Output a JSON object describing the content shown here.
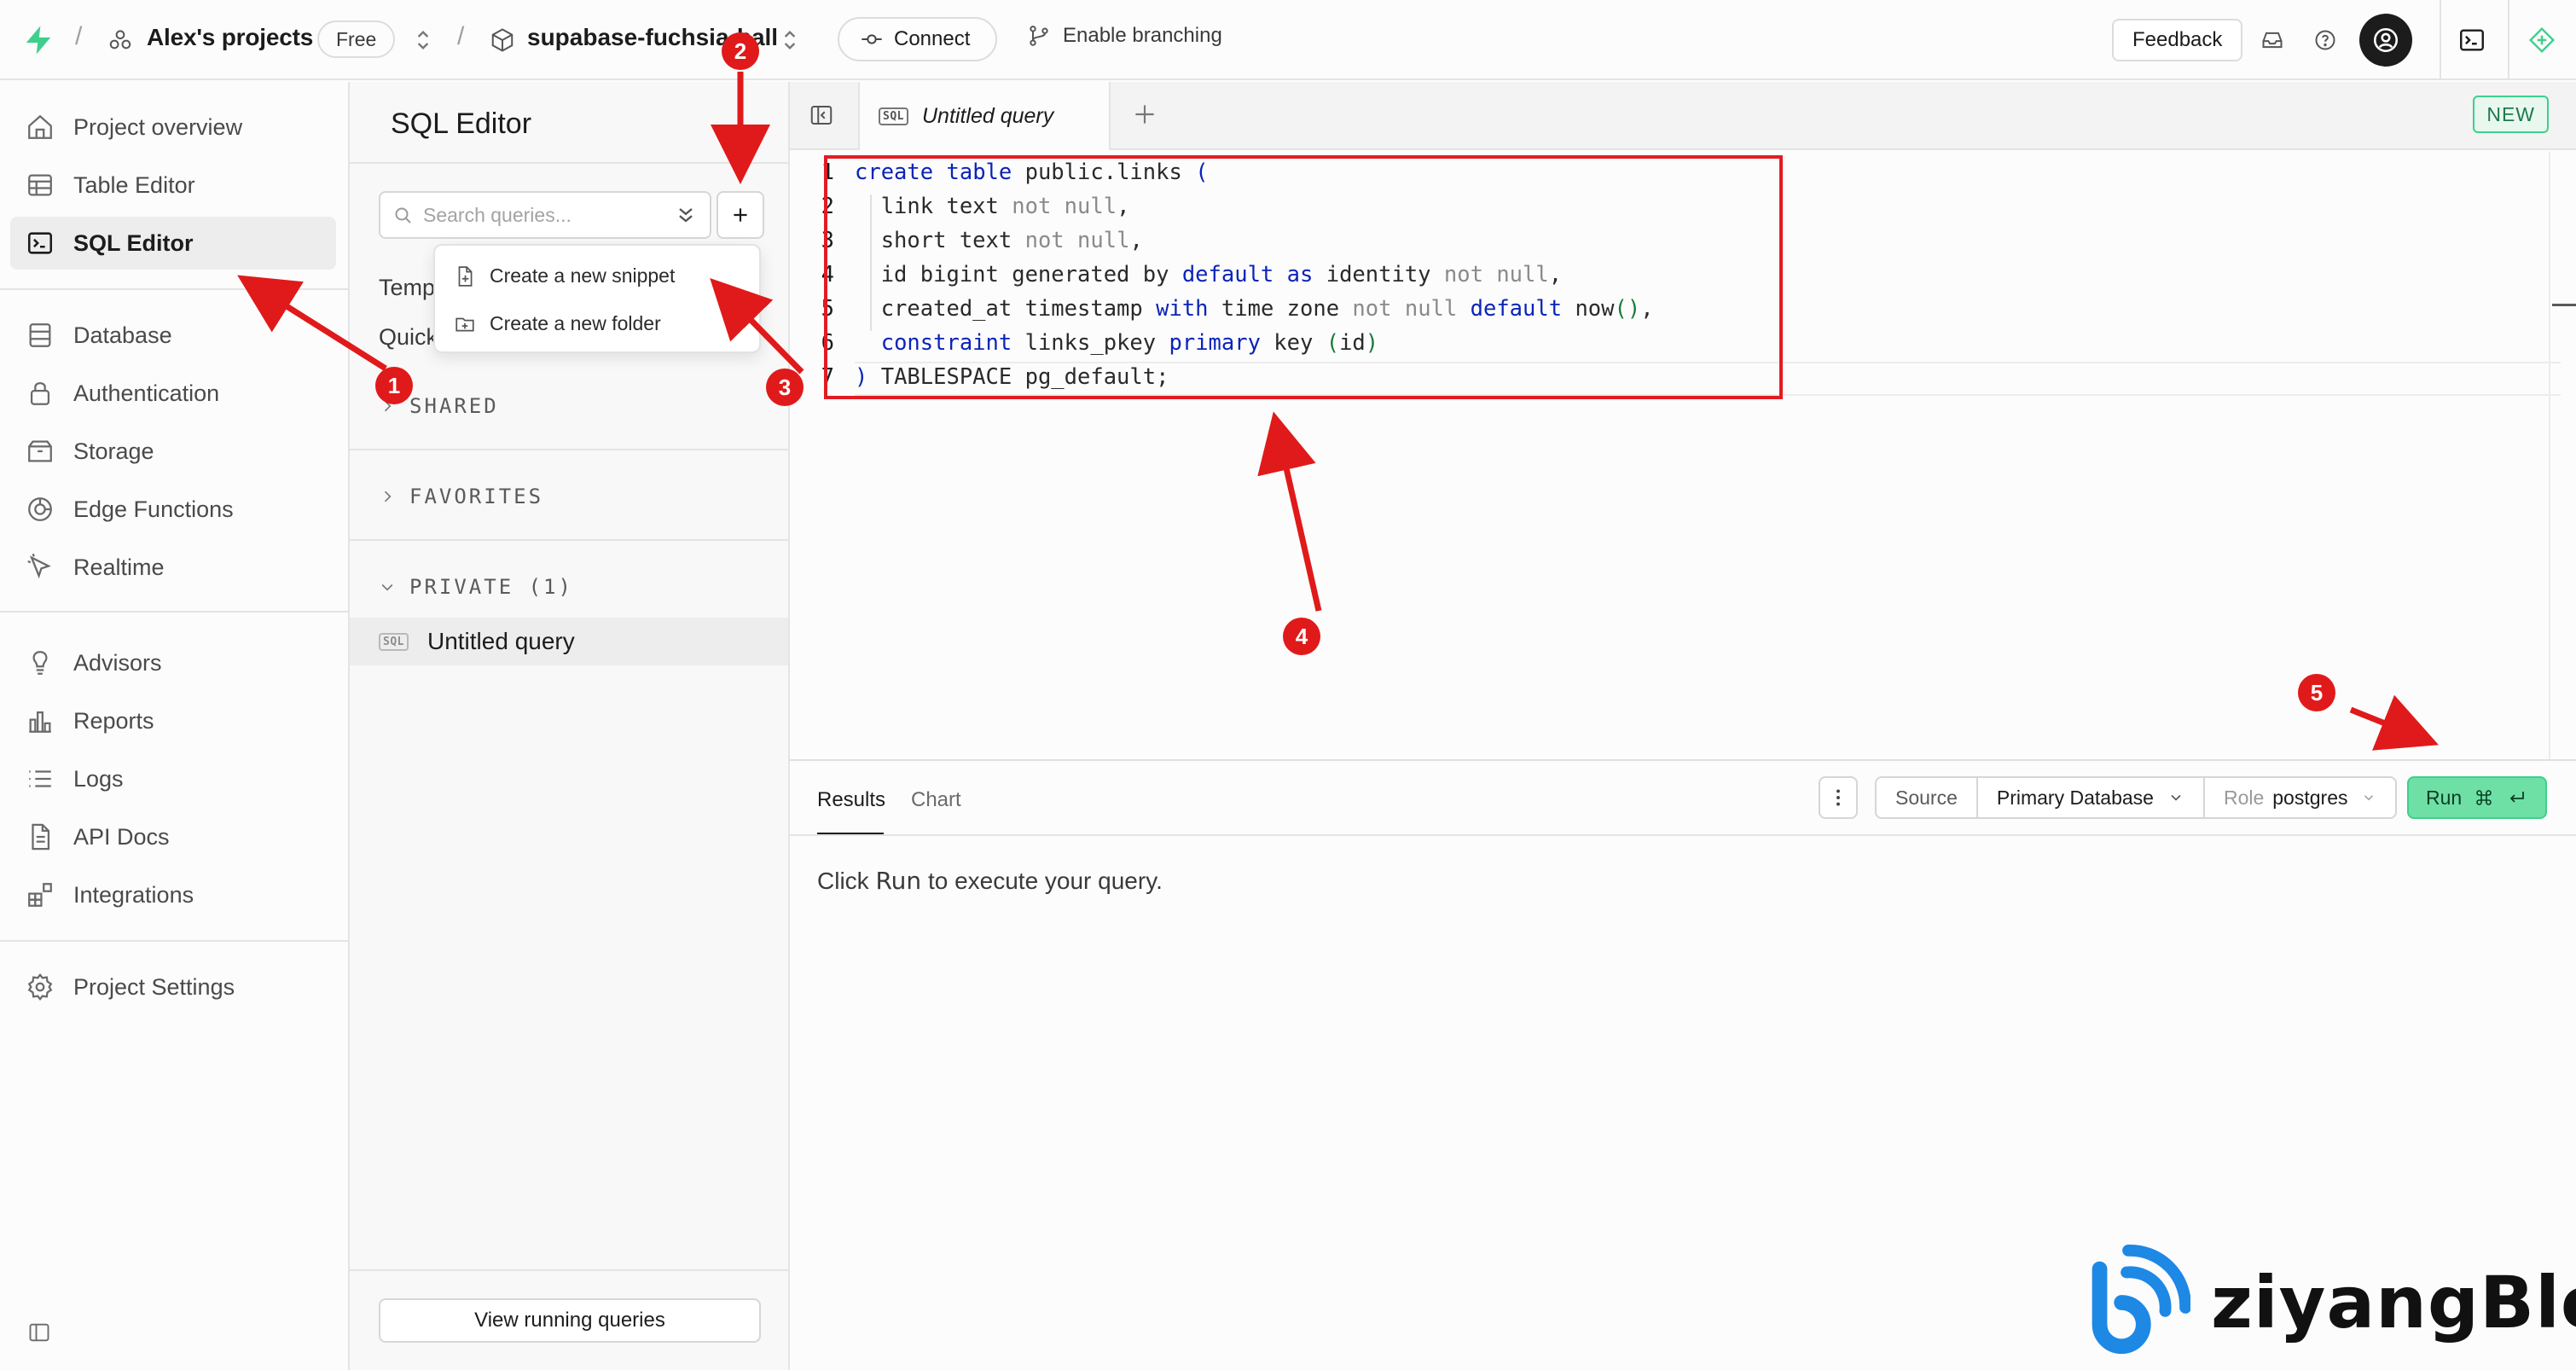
{
  "topbar": {
    "org_name": "Alex's projects",
    "plan_badge": "Free",
    "project_name": "supabase-fuchsia-ball",
    "connect_label": "Connect",
    "branching_label": "Enable branching",
    "feedback_label": "Feedback"
  },
  "sidebar": {
    "items": [
      {
        "label": "Project overview",
        "icon": "home-icon"
      },
      {
        "label": "Table Editor",
        "icon": "table-icon"
      },
      {
        "label": "SQL Editor",
        "icon": "terminal-icon",
        "active": true
      },
      {
        "label": "Database",
        "icon": "database-icon"
      },
      {
        "label": "Authentication",
        "icon": "lock-icon"
      },
      {
        "label": "Storage",
        "icon": "archive-icon"
      },
      {
        "label": "Edge Functions",
        "icon": "functions-icon"
      },
      {
        "label": "Realtime",
        "icon": "cursor-icon"
      },
      {
        "label": "Advisors",
        "icon": "lightbulb-icon"
      },
      {
        "label": "Reports",
        "icon": "bar-chart-icon"
      },
      {
        "label": "Logs",
        "icon": "list-icon"
      },
      {
        "label": "API Docs",
        "icon": "file-icon"
      },
      {
        "label": "Integrations",
        "icon": "blocks-icon"
      },
      {
        "label": "Project Settings",
        "icon": "gear-icon"
      }
    ]
  },
  "panel": {
    "title": "SQL Editor",
    "search_placeholder": "Search queries...",
    "templates_stub": "Temp",
    "quickstarts_stub": "Quick",
    "sections": {
      "shared": "SHARED",
      "favorites": "FAVORITES",
      "private": "PRIVATE (1)"
    },
    "query_tag": "SQL",
    "query_name": "Untitled query",
    "view_running_label": "View running queries"
  },
  "popup": {
    "new_snippet": "Create a new snippet",
    "new_folder": "Create a new folder"
  },
  "editor": {
    "tab_label": "Untitled query",
    "tab_tag": "SQL",
    "new_badge": "NEW",
    "line_numbers": [
      "1",
      "2",
      "3",
      "4",
      "5",
      "6",
      "7"
    ]
  },
  "results": {
    "tabs": [
      "Results",
      "Chart"
    ],
    "source_label": "Source",
    "database_value": "Primary Database",
    "role_label": "Role",
    "role_value": "postgres",
    "run_label": "Run",
    "message_prefix": "Click",
    "message_run": "Run",
    "message_suffix": "to execute your query."
  },
  "annotations": [
    "1",
    "2",
    "3",
    "4",
    "5"
  ],
  "watermark": "ziyangBlog",
  "colors": {
    "accent_green": "#3ecf8e",
    "annotation_red": "#e01a1a",
    "keyword_blue": "#0b24b8"
  }
}
